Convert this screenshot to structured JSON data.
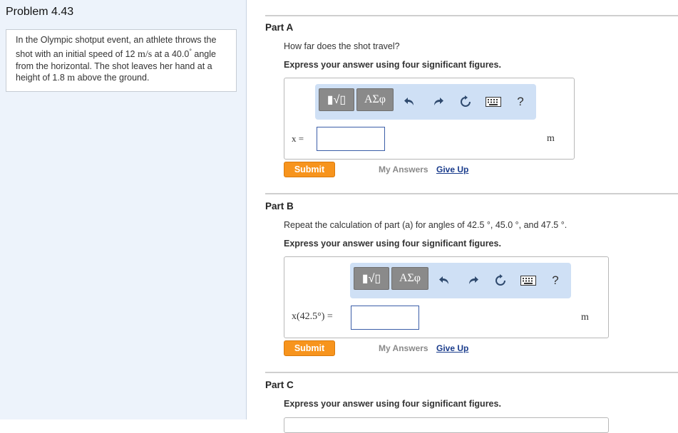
{
  "problem": {
    "title": "Problem 4.43",
    "text_1": "In the Olympic shotput event, an athlete throws the shot with an initial speed of 12 ",
    "speed_unit": "m/s",
    "text_2": " at a 40.0",
    "deg": "°",
    "text_3": " angle from the horizontal. The shot leaves her hand at a height of 1.8 ",
    "height_unit": "m",
    "text_4": " above the ground."
  },
  "toolbar": {
    "templates_label": "▮√▯",
    "symbols_label": "ΑΣφ",
    "help_label": "?"
  },
  "icons": [
    "templates-icon",
    "undo-icon",
    "redo-icon",
    "reset-icon",
    "keyboard-icon",
    "help-icon"
  ],
  "colors": {
    "submit": "#f7941d",
    "toolbar": "#cfe0f5",
    "input_border": "#3b5ea8",
    "link": "#1a3c8c"
  },
  "part_a": {
    "title": "Part A",
    "question": "How far does the shot travel?",
    "instruction": "Express your answer using four significant figures.",
    "var_label": "x =",
    "input_value": "",
    "unit": "m",
    "submit": "Submit",
    "my_answers": "My Answers",
    "give_up": "Give Up"
  },
  "part_b": {
    "title": "Part B",
    "question": "Repeat the calculation of part (a) for angles of 42.5 °, 45.0 °, and 47.5 °.",
    "instruction": "Express your answer using four significant figures.",
    "var_label": "x(42.5°) =",
    "input_value": "",
    "unit": "m",
    "submit": "Submit",
    "my_answers": "My Answers",
    "give_up": "Give Up"
  },
  "part_c": {
    "title": "Part C",
    "instruction": "Express your answer using four significant figures."
  }
}
